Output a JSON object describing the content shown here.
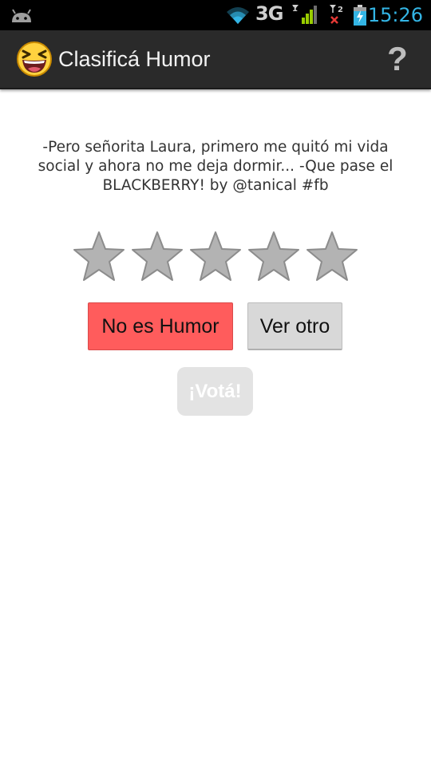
{
  "status_bar": {
    "network_type": "3G",
    "time": "15:26",
    "icons": [
      "android-debug-icon",
      "wifi-icon",
      "signal-icon",
      "sim2-no-signal-icon",
      "battery-charging-icon"
    ],
    "clock_color": "#33b5e5"
  },
  "action_bar": {
    "title": "Clasificá Humor",
    "app_icon": "laughing-face-icon",
    "help_label": "?",
    "background": "#2a2a2a"
  },
  "content": {
    "joke_text": "-Pero señorita Laura, primero me quitó mi vida social y ahora no me deja dormir... -Que pase el BLACKBERRY! by @tanical #fb",
    "rating": {
      "stars_total": 5,
      "stars_filled": 0,
      "star_color": "#b3b3b3"
    },
    "buttons": {
      "no_humor_label": "No es Humor",
      "ver_otro_label": "Ver otro",
      "vota_label": "¡Votá!",
      "no_humor_color": "#ff5c5c",
      "vota_enabled": false
    }
  }
}
